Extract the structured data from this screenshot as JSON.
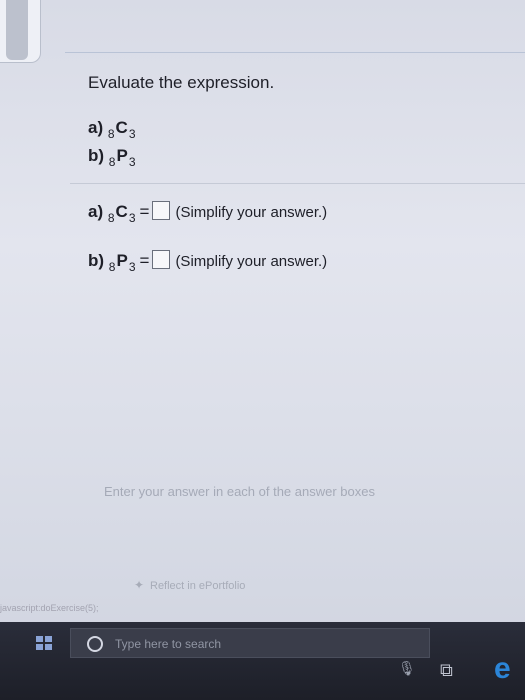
{
  "question": {
    "title": "Evaluate the expression.",
    "items": [
      {
        "label": "a)",
        "n": "8",
        "letter": "C",
        "r": "3"
      },
      {
        "label": "b)",
        "n": "8",
        "letter": "P",
        "r": "3"
      }
    ]
  },
  "answers": [
    {
      "label": "a)",
      "n": "8",
      "letter": "C",
      "r": "3",
      "equals": "=",
      "hint": "(Simplify your answer.)"
    },
    {
      "label": "b)",
      "n": "8",
      "letter": "P",
      "r": "3",
      "equals": "=",
      "hint": "(Simplify your answer.)"
    }
  ],
  "instruction": "Enter your answer in each of the answer boxes",
  "reflect": "Reflect in ePortfolio",
  "status": "javascript:doExercise(5);",
  "taskbar": {
    "search_placeholder": "Type here to search",
    "edge_label": "e"
  },
  "icons": {
    "windows": "windows-start-icon",
    "search": "cortana-circle-icon",
    "mic": "microphone-icon",
    "taskview": "task-view-icon",
    "edge": "edge-browser-icon"
  }
}
